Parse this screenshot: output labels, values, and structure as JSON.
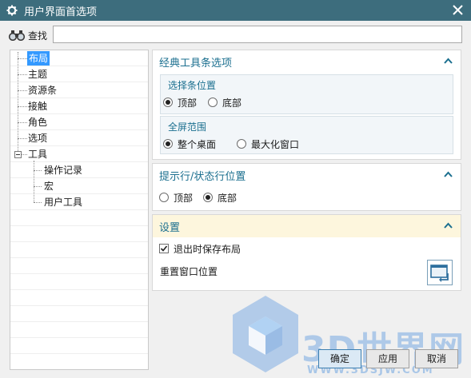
{
  "window": {
    "title": "用户界面首选项"
  },
  "search": {
    "label": "查找",
    "value": "",
    "placeholder": ""
  },
  "tree": {
    "items": [
      {
        "label": "布局",
        "selected": true
      },
      {
        "label": "主题"
      },
      {
        "label": "资源条"
      },
      {
        "label": "接触"
      },
      {
        "label": "角色"
      },
      {
        "label": "选项"
      },
      {
        "label": "工具",
        "expanded": true
      },
      {
        "label": "操作记录"
      },
      {
        "label": "宏"
      },
      {
        "label": "用户工具"
      }
    ]
  },
  "classic_toolbar": {
    "title": "经典工具条选项",
    "resource_bar_position": {
      "title": "选择条位置",
      "options": [
        {
          "label": "顶部",
          "checked": true
        },
        {
          "label": "底部",
          "checked": false
        }
      ]
    },
    "fullscreen_range": {
      "title": "全屏范围",
      "options": [
        {
          "label": "整个桌面",
          "checked": true
        },
        {
          "label": "最大化窗口",
          "checked": false
        }
      ]
    }
  },
  "prompt_status": {
    "title": "提示行/状态行位置",
    "options": [
      {
        "label": "顶部",
        "checked": false
      },
      {
        "label": "底部",
        "checked": true
      }
    ]
  },
  "settings": {
    "title": "设置",
    "save_on_exit": {
      "label": "退出时保存布局",
      "checked": true
    },
    "reset_window": {
      "label": "重置窗口位置"
    }
  },
  "buttons": {
    "ok": "确定",
    "apply": "应用",
    "cancel": "取消"
  },
  "watermark": {
    "brand": "3D世界网",
    "url": "WWW.3DSJW.COM"
  },
  "colors": {
    "titlebar": "#3d6d7d",
    "accent": "#1b6f8f",
    "selection": "#3399ff",
    "settings_header": "#fdf6dd"
  }
}
